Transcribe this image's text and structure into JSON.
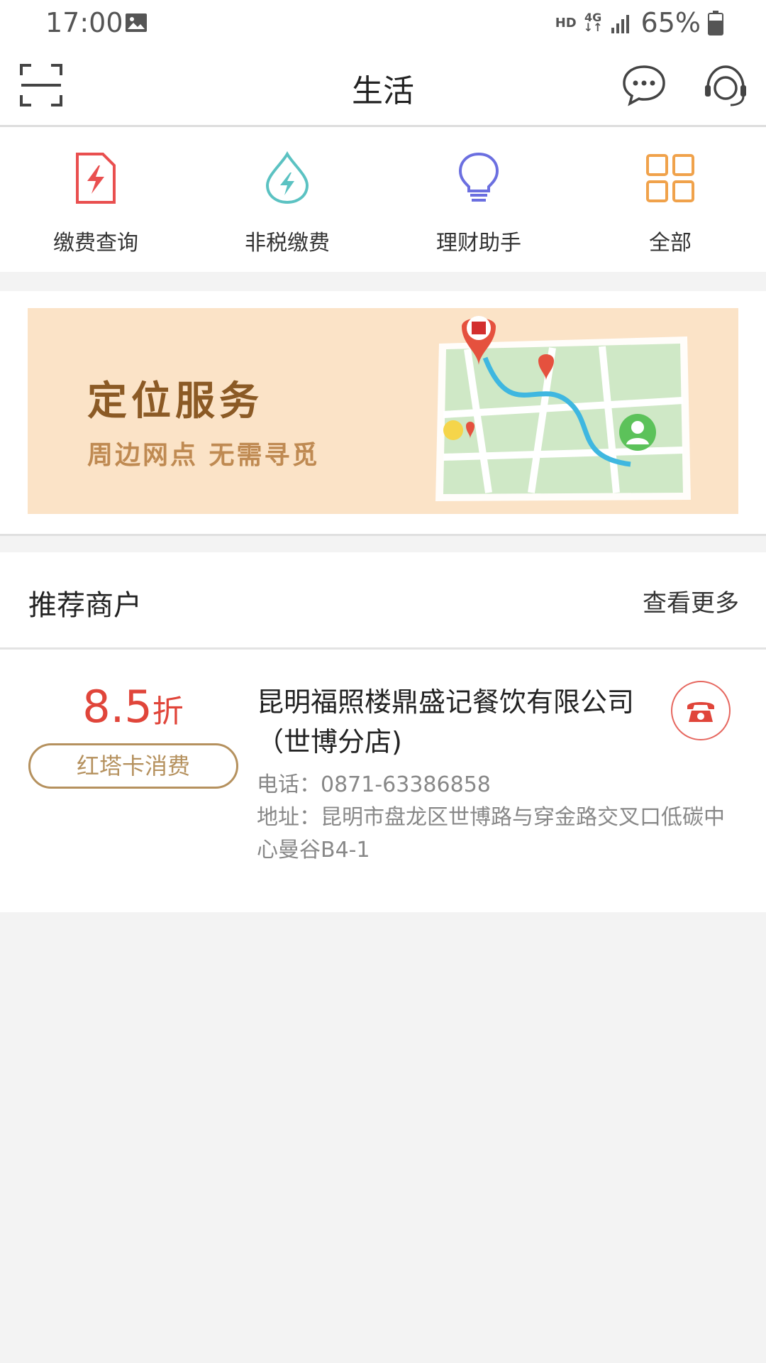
{
  "status_bar": {
    "time": "17:00",
    "hd": "HD",
    "network": "4G",
    "battery": "65%"
  },
  "header": {
    "title": "生活",
    "scan_icon": "scan-icon",
    "message_icon": "chat-bubble-icon",
    "service_icon": "headset-icon"
  },
  "quick_menu": [
    {
      "label": "缴费查询",
      "icon": "bill-lightning-icon",
      "color": "#e94f4f"
    },
    {
      "label": "非税缴费",
      "icon": "water-drop-lightning-icon",
      "color": "#5bc2c2"
    },
    {
      "label": "理财助手",
      "icon": "lightbulb-icon",
      "color": "#6b6fe0"
    },
    {
      "label": "全部",
      "icon": "grid-icon",
      "color": "#f0a24b"
    }
  ],
  "banner": {
    "title": "定位服务",
    "subtitle": "周边网点 无需寻觅"
  },
  "recommend": {
    "title": "推荐商户",
    "more": "查看更多"
  },
  "merchant": {
    "discount_value": "8.5",
    "discount_unit": "折",
    "tag": "红塔卡消费",
    "name": "昆明福照楼鼎盛记餐饮有限公司（世博分店)",
    "phone": "电话：0871-63386858",
    "address": "地址：昆明市盘龙区世博路与穿金路交叉口低碳中心曼谷B4-1"
  },
  "colors": {
    "accent_red": "#e0453a",
    "tag_gold": "#b5915e",
    "banner_bg": "#fbe3c7"
  }
}
